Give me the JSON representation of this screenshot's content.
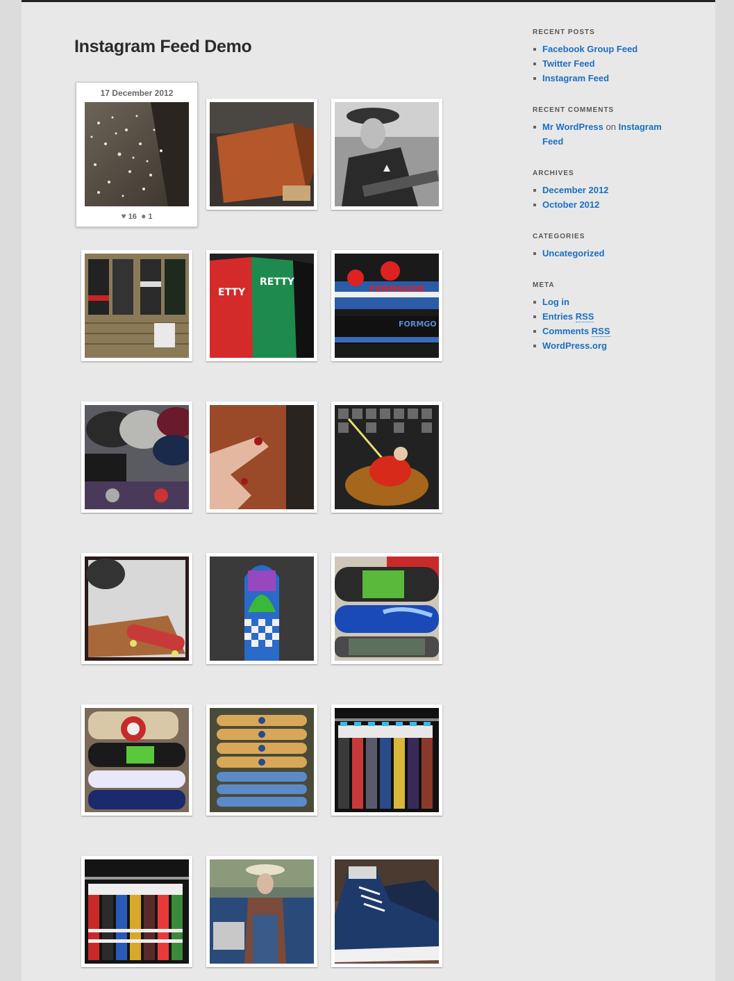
{
  "page": {
    "title": "Instagram Feed Demo"
  },
  "feed": {
    "featured": {
      "date": "17 December 2012",
      "likes": "16",
      "comments": "1",
      "icons": {
        "likes": "heart-icon",
        "comments": "speech-bubble-icon"
      }
    },
    "photos": [
      {
        "subject": "hail on ground"
      },
      {
        "subject": "wooden skate ramp"
      },
      {
        "subject": "cowboy with guitar"
      },
      {
        "subject": "skate gloves on wall"
      },
      {
        "subject": "t-shirts red and green"
      },
      {
        "subject": "knit beanies"
      },
      {
        "subject": "caps on shelf"
      },
      {
        "subject": "injured finger"
      },
      {
        "subject": "elf in bowl"
      },
      {
        "subject": "skateboard on ramp"
      },
      {
        "subject": "checkered longboard"
      },
      {
        "subject": "skateboard decks stacked"
      },
      {
        "subject": "skateboard decks on wall"
      },
      {
        "subject": "longboard decks"
      },
      {
        "subject": "socks on rack"
      },
      {
        "subject": "striped socks"
      },
      {
        "subject": "old man by truck"
      },
      {
        "subject": "blue sneakers"
      }
    ]
  },
  "sidebar": {
    "recent_posts": {
      "heading": "RECENT POSTS",
      "items": [
        "Facebook Group Feed",
        "Twitter Feed",
        "Instagram Feed"
      ]
    },
    "recent_comments": {
      "heading": "RECENT COMMENTS",
      "author": "Mr WordPress",
      "joiner": "on",
      "post_line1": "Instagram",
      "post_line2": "Feed"
    },
    "archives": {
      "heading": "ARCHIVES",
      "items": [
        "December 2012",
        "October 2012"
      ]
    },
    "categories": {
      "heading": "CATEGORIES",
      "items": [
        "Uncategorized"
      ]
    },
    "meta": {
      "heading": "META",
      "log_in": "Log in",
      "entries_prefix": "Entries ",
      "entries_abbr": "RSS",
      "comments_prefix": "Comments ",
      "comments_abbr": "RSS",
      "wordpress": "WordPress.org"
    }
  }
}
